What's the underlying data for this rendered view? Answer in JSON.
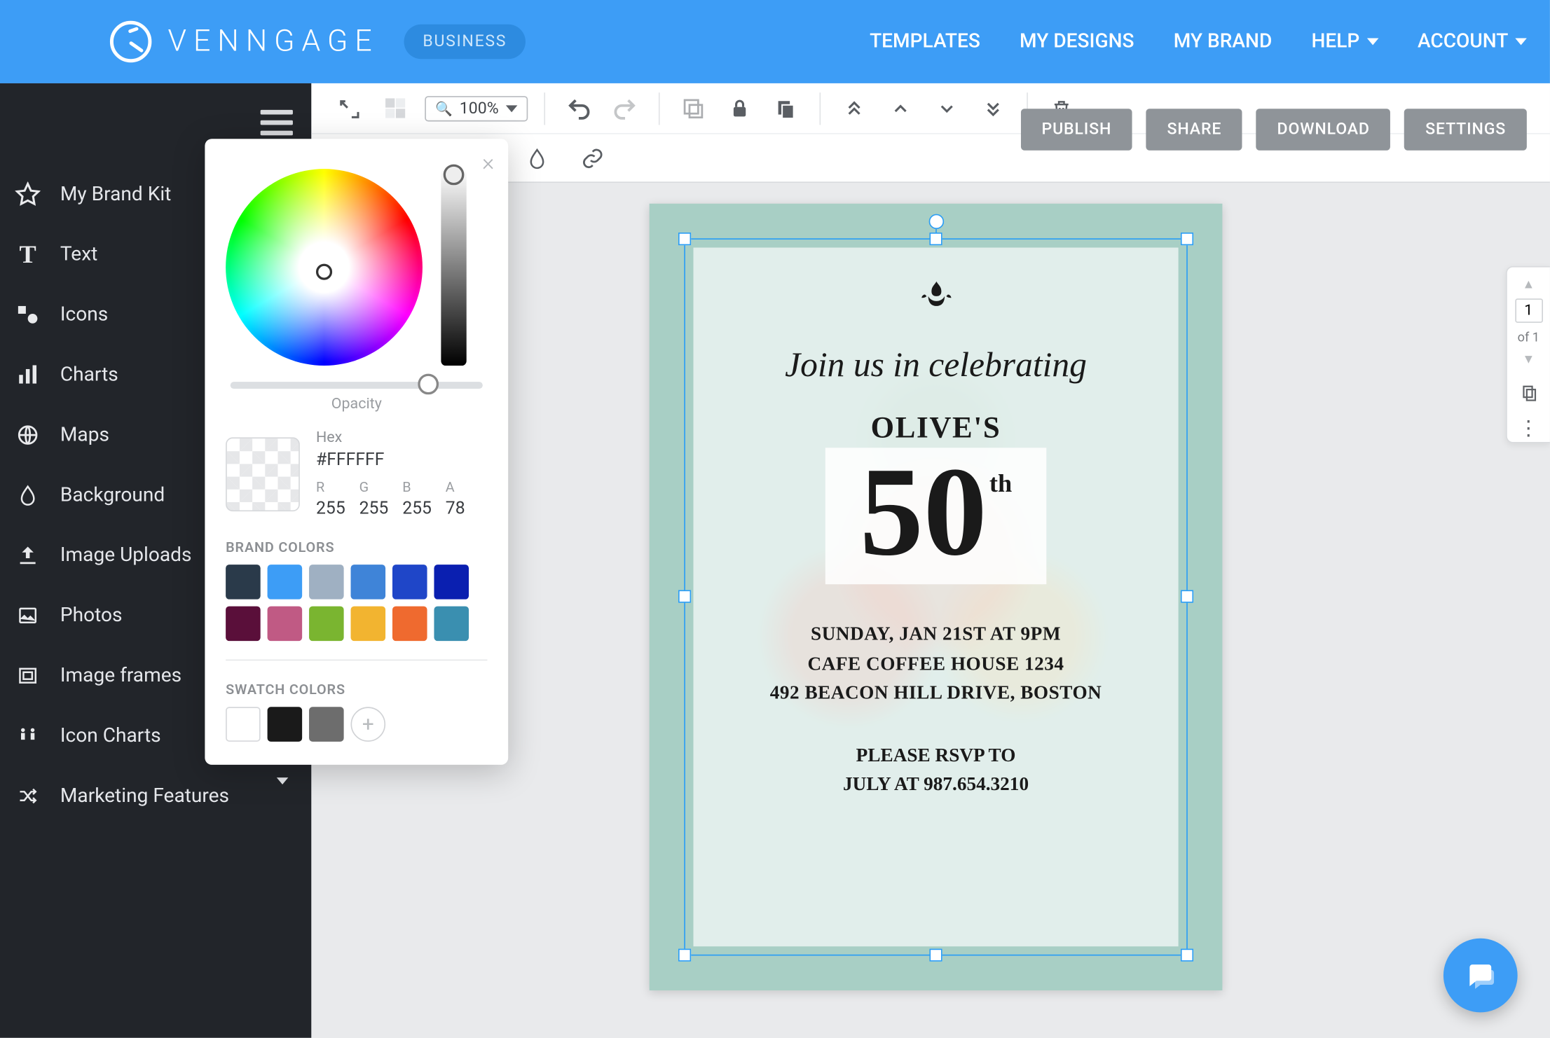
{
  "header": {
    "brand": "VENNGAGE",
    "plan_badge": "BUSINESS",
    "nav": {
      "templates": "TEMPLATES",
      "my_designs": "MY DESIGNS",
      "my_brand": "MY BRAND",
      "help": "HELP",
      "account": "ACCOUNT"
    }
  },
  "sidebar": {
    "items": [
      {
        "label": "My Brand Kit"
      },
      {
        "label": "Text"
      },
      {
        "label": "Icons"
      },
      {
        "label": "Charts"
      },
      {
        "label": "Maps"
      },
      {
        "label": "Background"
      },
      {
        "label": "Image Uploads"
      },
      {
        "label": "Photos"
      },
      {
        "label": "Image frames"
      },
      {
        "label": "Icon Charts"
      },
      {
        "label": "Marketing Features"
      }
    ]
  },
  "toolbar": {
    "zoom": "100%",
    "actions": {
      "publish": "PUBLISH",
      "share": "SHARE",
      "download": "DOWNLOAD",
      "settings": "SETTINGS"
    }
  },
  "color_picker": {
    "opacity_label": "Opacity",
    "hex_label": "Hex",
    "hex_value": "#FFFFFF",
    "r_label": "R",
    "g_label": "G",
    "b_label": "B",
    "a_label": "A",
    "r": "255",
    "g": "255",
    "b": "255",
    "a": "78",
    "brand_label": "BRAND COLORS",
    "brand_colors": [
      "#2a3a4a",
      "#3d9df6",
      "#9fb0c2",
      "#3f84d8",
      "#1f46c8",
      "#0a1fb0",
      "#5a0f3a",
      "#c05a84",
      "#7ab530",
      "#f2b430",
      "#ef6a2f",
      "#3a8fb0"
    ],
    "swatch_label": "SWATCH COLORS",
    "swatch_colors": [
      "#ffffff",
      "#1a1a1a",
      "#6d6d6d"
    ]
  },
  "canvas": {
    "script_line": "Join us in celebrating",
    "name_line": "OLIVE'S",
    "age_num": "50",
    "age_suffix": "th",
    "detail1": "SUNDAY, JAN 21ST AT 9PM",
    "detail2": "CAFE COFFEE HOUSE 1234",
    "detail3": "492 BEACON HILL DRIVE, BOSTON",
    "rsvp1": "PLEASE RSVP TO",
    "rsvp2": "JULY AT 987.654.3210"
  },
  "page_nav": {
    "current": "1",
    "of_label": "of 1"
  }
}
